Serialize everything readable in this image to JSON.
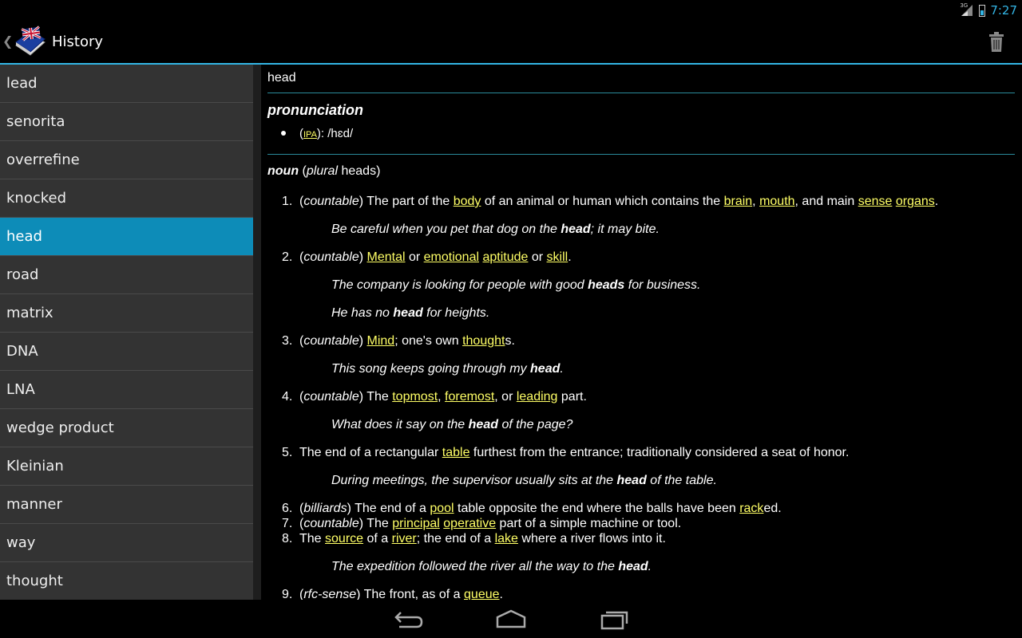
{
  "status": {
    "network": "3G",
    "time": "7:27"
  },
  "actionbar": {
    "title": "History",
    "up_glyph": "❮",
    "trash_icon": "trash-icon"
  },
  "history": [
    {
      "label": "lead"
    },
    {
      "label": "senorita"
    },
    {
      "label": "overrefine"
    },
    {
      "label": "knocked"
    },
    {
      "label": "head",
      "selected": true
    },
    {
      "label": "road"
    },
    {
      "label": "matrix"
    },
    {
      "label": "DNA"
    },
    {
      "label": "LNA"
    },
    {
      "label": "wedge product"
    },
    {
      "label": "Kleinian"
    },
    {
      "label": "manner"
    },
    {
      "label": "way"
    },
    {
      "label": "thought"
    }
  ],
  "entry": {
    "word": "head",
    "pronunciation": {
      "heading": "pronunciation",
      "ipa_label": "IPA",
      "ipa_value": ": /hɛd/"
    },
    "pos": {
      "name": "noun",
      "plural_label": "plural",
      "plural_form": "heads"
    },
    "definitions": [
      {
        "num": "1.",
        "html": "(<i>countable</i>) The part of the <a>body</a> of an animal or human which contains the <a>brain</a>, <a>mouth</a>, and main <a>sense</a> <a>organs</a>."
      },
      {
        "num": "2.",
        "html": "(<i>countable</i>) <a>Mental</a> or <a>emotional</a> <a>aptitude</a> or <a>skill</a>."
      },
      {
        "num": "3.",
        "html": "(<i>countable</i>) <a>Mind</a>; one's own <a>thought</a>s."
      },
      {
        "num": "4.",
        "html": "(<i>countable</i>) The <a>topmost</a>, <a>foremost</a>, or <a>leading</a> part."
      },
      {
        "num": "5.",
        "html": "The end of a rectangular <a>table</a> furthest from the entrance; traditionally considered a seat of honor."
      },
      {
        "num": "6.",
        "html": "(<i>billiards</i>) The end of a <a>pool</a> table opposite the end where the balls have been <a>rack</a>ed."
      },
      {
        "num": "7.",
        "html": "(<i>countable</i>) The <a>principal</a> <a>operative</a> part of a simple machine or tool."
      },
      {
        "num": "8.",
        "html": "The <a>source</a> of a <a>river</a>; the end of a <a>lake</a> where a river flows into it."
      },
      {
        "num": "9.",
        "html": "(<i>rfc-sense</i>) The front, as of a <a>queue</a>."
      }
    ],
    "examples": [
      "Be careful when you pet that dog on the <b>head</b>; it may bite.",
      "The company is looking for people with good <b>heads</b> for business.",
      "He has no <b>head</b> for heights.",
      "This song keeps going through my <b>head</b>.",
      "What does it say on the <b>head</b> of the page?",
      "During meetings, the supervisor usually sits at the <b>head</b> of the table.",
      "The expedition followed the river all the way to the <b>head</b>."
    ]
  },
  "colors": {
    "accent": "#33b5e5",
    "selected": "#0d8cb8",
    "link": "#ffff66"
  }
}
